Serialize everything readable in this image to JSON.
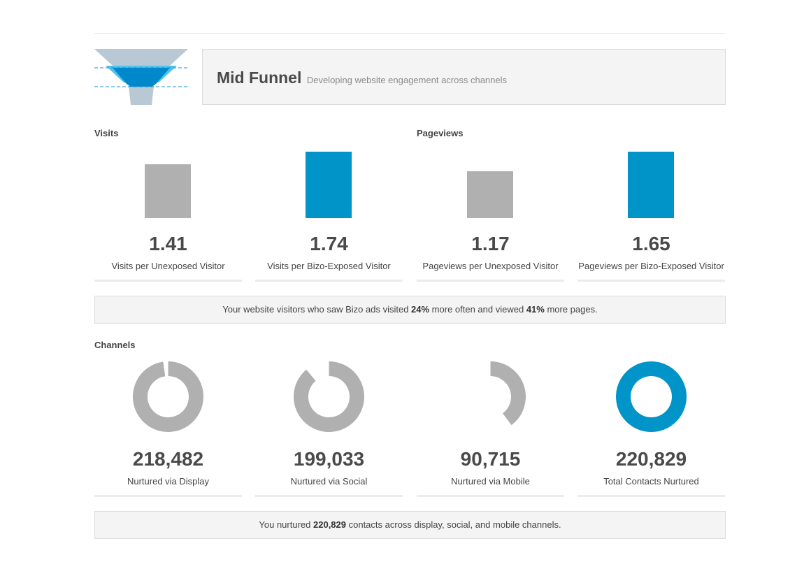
{
  "header": {
    "title": "Mid Funnel",
    "subtitle": "Developing website engagement across channels"
  },
  "colors": {
    "gray": "#b0b0b0",
    "blue": "#0094c8",
    "funnel_outer": "#b8c8d4",
    "funnel_light": "#4fc3ee",
    "funnel_dark": "#0088cc",
    "dash": "#1a8fd0"
  },
  "icons": {
    "funnel": "funnel-icon"
  },
  "sections": {
    "visits": "Visits",
    "pageviews": "Pageviews",
    "channels": "Channels"
  },
  "summary1": {
    "prefix": "Your website visitors who saw Bizo ads visited ",
    "visits_pct": "24%",
    "middle": " more often and viewed ",
    "pages_pct": "41%",
    "suffix": " more pages."
  },
  "summary2": {
    "prefix": "You nurtured ",
    "total": "220,829",
    "suffix": " contacts across display, social, and mobile channels."
  },
  "chart_data": [
    {
      "type": "bar",
      "categories": [
        "Visits per Unexposed Visitor",
        "Visits per Bizo-Exposed Visitor"
      ],
      "values": [
        1.41,
        1.74
      ],
      "value_labels": [
        "1.41",
        "1.74"
      ],
      "colors": [
        "#b0b0b0",
        "#0094c8"
      ],
      "title": "Visits"
    },
    {
      "type": "bar",
      "categories": [
        "Pageviews per Unexposed Visitor",
        "Pageviews per Bizo-Exposed Visitor"
      ],
      "values": [
        1.17,
        1.65
      ],
      "value_labels": [
        "1.17",
        "1.65"
      ],
      "colors": [
        "#b0b0b0",
        "#0094c8"
      ],
      "title": "Pageviews"
    },
    {
      "type": "pie",
      "style": "donut",
      "title": "Channels",
      "categories": [
        "Nurtured via Display",
        "Nurtured via Social",
        "Nurtured via Mobile",
        "Total Contacts Nurtured"
      ],
      "values": [
        218482,
        199033,
        90715,
        220829
      ],
      "value_labels": [
        "218,482",
        "199,033",
        "90,715",
        "220,829"
      ],
      "total": 220829,
      "colors": [
        "#b0b0b0",
        "#b0b0b0",
        "#b0b0b0",
        "#0094c8"
      ]
    }
  ]
}
